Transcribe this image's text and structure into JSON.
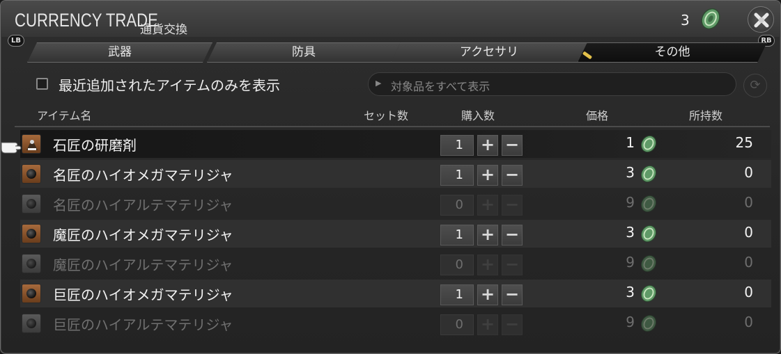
{
  "window": {
    "title": "CURRENCY TRADE",
    "subtitle": "通貨交換",
    "currency_count": "3",
    "lb_label": "LB",
    "rb_label": "RB"
  },
  "tabs": [
    {
      "label": "武器",
      "active": false
    },
    {
      "label": "防具",
      "active": false
    },
    {
      "label": "アクセサリ",
      "active": false
    },
    {
      "label": "その他",
      "active": true
    }
  ],
  "filter": {
    "checkbox_label": "最近追加されたアイテムのみを表示",
    "checkbox_checked": false,
    "dropdown_value": "対象品をすべて表示"
  },
  "columns": {
    "item": "アイテム名",
    "set": "セット数",
    "buy": "購入数",
    "price": "価格",
    "owned": "所持数"
  },
  "items": [
    {
      "name": "石匠の研磨剤",
      "qty": "1",
      "price": "1",
      "owned": "25",
      "available": true
    },
    {
      "name": "名匠のハイオメガマテリジャ",
      "qty": "1",
      "price": "3",
      "owned": "0",
      "available": true
    },
    {
      "name": "名匠のハイアルテマテリジャ",
      "qty": "0",
      "price": "9",
      "owned": "0",
      "available": false
    },
    {
      "name": "魔匠のハイオメガマテリジャ",
      "qty": "1",
      "price": "3",
      "owned": "0",
      "available": true
    },
    {
      "name": "魔匠のハイアルテマテリジャ",
      "qty": "0",
      "price": "9",
      "owned": "0",
      "available": false
    },
    {
      "name": "巨匠のハイオメガマテリジャ",
      "qty": "1",
      "price": "3",
      "owned": "0",
      "available": true
    },
    {
      "name": "巨匠のハイアルテマテリジャ",
      "qty": "0",
      "price": "9",
      "owned": "0",
      "available": false
    }
  ],
  "colors": {
    "accent": "#e3c04a",
    "currency_green": "#6fa872"
  }
}
